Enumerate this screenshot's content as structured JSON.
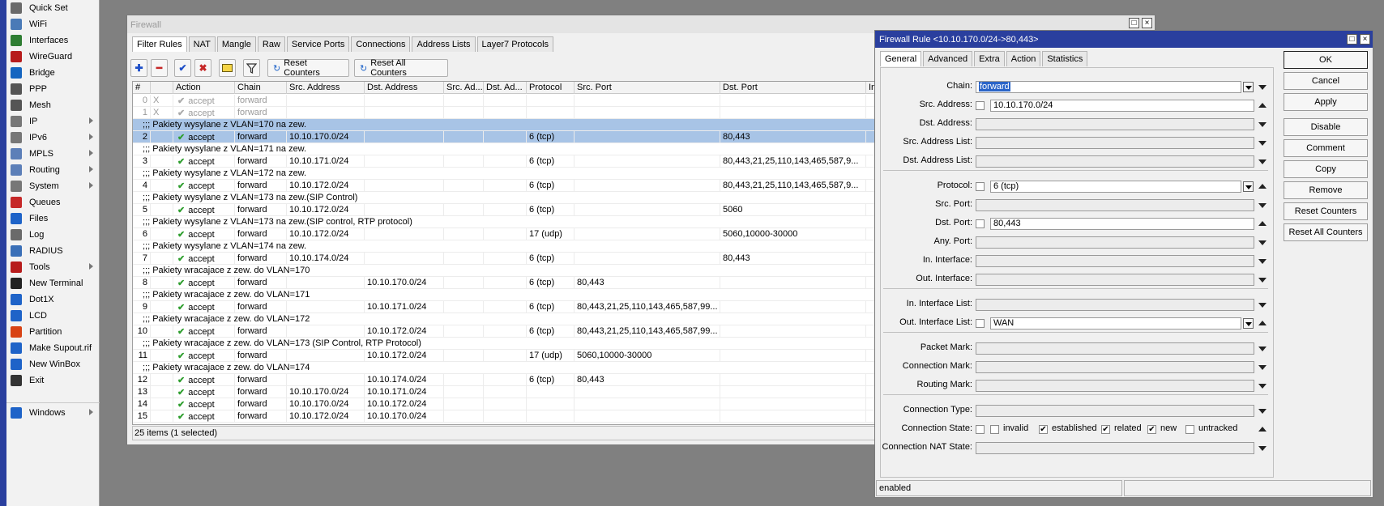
{
  "sidebar": {
    "items": [
      {
        "label": "Quick Set",
        "icon": "quick-set-icon",
        "color": "#6a6a6a",
        "sub": false
      },
      {
        "label": "WiFi",
        "icon": "wifi-icon",
        "color": "#4a7ab7",
        "sub": false
      },
      {
        "label": "Interfaces",
        "icon": "interfaces-icon",
        "color": "#2e7d32",
        "sub": false
      },
      {
        "label": "WireGuard",
        "icon": "wireguard-icon",
        "color": "#b71c1c",
        "sub": false
      },
      {
        "label": "Bridge",
        "icon": "bridge-icon",
        "color": "#1565c0",
        "sub": false
      },
      {
        "label": "PPP",
        "icon": "ppp-icon",
        "color": "#555555",
        "sub": false
      },
      {
        "label": "Mesh",
        "icon": "mesh-icon",
        "color": "#555555",
        "sub": false
      },
      {
        "label": "IP",
        "icon": "ip-icon",
        "color": "#777777",
        "sub": true
      },
      {
        "label": "IPv6",
        "icon": "ipv6-icon",
        "color": "#777777",
        "sub": true
      },
      {
        "label": "MPLS",
        "icon": "mpls-icon",
        "color": "#5c7fb8",
        "sub": true
      },
      {
        "label": "Routing",
        "icon": "routing-icon",
        "color": "#5c7fb8",
        "sub": true
      },
      {
        "label": "System",
        "icon": "system-icon",
        "color": "#777777",
        "sub": true
      },
      {
        "label": "Queues",
        "icon": "queues-icon",
        "color": "#c62828",
        "sub": false
      },
      {
        "label": "Files",
        "icon": "files-icon",
        "color": "#1e63c8",
        "sub": false
      },
      {
        "label": "Log",
        "icon": "log-icon",
        "color": "#6a6a6a",
        "sub": false
      },
      {
        "label": "RADIUS",
        "icon": "radius-icon",
        "color": "#3a6fb7",
        "sub": false
      },
      {
        "label": "Tools",
        "icon": "tools-icon",
        "color": "#b71c1c",
        "sub": true
      },
      {
        "label": "New Terminal",
        "icon": "terminal-icon",
        "color": "#222222",
        "sub": false
      },
      {
        "label": "Dot1X",
        "icon": "dot1x-icon",
        "color": "#1e63c8",
        "sub": false
      },
      {
        "label": "LCD",
        "icon": "lcd-icon",
        "color": "#1e63c8",
        "sub": false
      },
      {
        "label": "Partition",
        "icon": "partition-icon",
        "color": "#d84315",
        "sub": false
      },
      {
        "label": "Make Supout.rif",
        "icon": "supout-icon",
        "color": "#1e63c8",
        "sub": false
      },
      {
        "label": "New WinBox",
        "icon": "winbox-icon",
        "color": "#1e63c8",
        "sub": false
      },
      {
        "label": "Exit",
        "icon": "exit-icon",
        "color": "#333333",
        "sub": false
      },
      {
        "label": "Windows",
        "icon": "windows-icon",
        "color": "#1e63c8",
        "sub": true
      }
    ]
  },
  "firewall": {
    "title": "Firewall",
    "tabs": [
      "Filter Rules",
      "NAT",
      "Mangle",
      "Raw",
      "Service Ports",
      "Connections",
      "Address Lists",
      "Layer7 Protocols"
    ],
    "toolbar": {
      "reset_counters": "Reset Counters",
      "reset_all_counters": "Reset All Counters"
    },
    "columns": [
      "#",
      "",
      "Action",
      "Chain",
      "Src. Address",
      "Dst. Address",
      "Src. Ad...",
      "Dst. Ad...",
      "Protocol",
      "Src. Port",
      "Dst. Port",
      "In."
    ],
    "rows": [
      {
        "type": "rule",
        "num": "0",
        "x": "X",
        "action": "accept",
        "chain": "forward",
        "src": "",
        "dst": "",
        "proto": "",
        "sport": "",
        "dport": "",
        "disabled": true
      },
      {
        "type": "rule",
        "num": "1",
        "x": "X",
        "action": "accept",
        "chain": "forward",
        "src": "",
        "dst": "",
        "proto": "",
        "sport": "",
        "dport": "",
        "disabled": true
      },
      {
        "type": "comment",
        "text": ";;; Pakiety wysylane z VLAN=170 na zew.",
        "sel": true
      },
      {
        "type": "rule",
        "num": "2",
        "x": "",
        "action": "accept",
        "chain": "forward",
        "src": "10.10.170.0/24",
        "dst": "",
        "proto": "6 (tcp)",
        "sport": "",
        "dport": "80,443",
        "sel": true
      },
      {
        "type": "comment",
        "text": ";;; Pakiety wysylane z VLAN=171 na zew."
      },
      {
        "type": "rule",
        "num": "3",
        "x": "",
        "action": "accept",
        "chain": "forward",
        "src": "10.10.171.0/24",
        "dst": "",
        "proto": "6 (tcp)",
        "sport": "",
        "dport": "80,443,21,25,110,143,465,587,9..."
      },
      {
        "type": "comment",
        "text": ";;; Pakiety wysylane z VLAN=172 na zew."
      },
      {
        "type": "rule",
        "num": "4",
        "x": "",
        "action": "accept",
        "chain": "forward",
        "src": "10.10.172.0/24",
        "dst": "",
        "proto": "6 (tcp)",
        "sport": "",
        "dport": "80,443,21,25,110,143,465,587,9..."
      },
      {
        "type": "comment",
        "text": ";;; Pakiety wysylane z VLAN=173 na zew.(SIP Control)"
      },
      {
        "type": "rule",
        "num": "5",
        "x": "",
        "action": "accept",
        "chain": "forward",
        "src": "10.10.172.0/24",
        "dst": "",
        "proto": "6 (tcp)",
        "sport": "",
        "dport": "5060"
      },
      {
        "type": "comment",
        "text": ";;; Pakiety wysylane z VLAN=173 na zew.(SIP control, RTP protocol)"
      },
      {
        "type": "rule",
        "num": "6",
        "x": "",
        "action": "accept",
        "chain": "forward",
        "src": "10.10.172.0/24",
        "dst": "",
        "proto": "17 (udp)",
        "sport": "",
        "dport": "5060,10000-30000"
      },
      {
        "type": "comment",
        "text": ";;; Pakiety wysylane z VLAN=174 na zew."
      },
      {
        "type": "rule",
        "num": "7",
        "x": "",
        "action": "accept",
        "chain": "forward",
        "src": "10.10.174.0/24",
        "dst": "",
        "proto": "6 (tcp)",
        "sport": "",
        "dport": "80,443"
      },
      {
        "type": "comment",
        "text": ";;; Pakiety wracajace z zew. do VLAN=170"
      },
      {
        "type": "rule",
        "num": "8",
        "x": "",
        "action": "accept",
        "chain": "forward",
        "src": "",
        "dst": "10.10.170.0/24",
        "proto": "6 (tcp)",
        "sport": "80,443",
        "dport": ""
      },
      {
        "type": "comment",
        "text": ";;; Pakiety wracajace z zew. do VLAN=171"
      },
      {
        "type": "rule",
        "num": "9",
        "x": "",
        "action": "accept",
        "chain": "forward",
        "src": "",
        "dst": "10.10.171.0/24",
        "proto": "6 (tcp)",
        "sport": "80,443,21,25,110,143,465,587,99...",
        "dport": ""
      },
      {
        "type": "comment",
        "text": ";;; Pakiety wracajace z zew. do VLAN=172"
      },
      {
        "type": "rule",
        "num": "10",
        "x": "",
        "action": "accept",
        "chain": "forward",
        "src": "",
        "dst": "10.10.172.0/24",
        "proto": "6 (tcp)",
        "sport": "80,443,21,25,110,143,465,587,99...",
        "dport": ""
      },
      {
        "type": "comment",
        "text": ";;; Pakiety wracajace z zew. do VLAN=173 (SIP Control, RTP Protocol)"
      },
      {
        "type": "rule",
        "num": "11",
        "x": "",
        "action": "accept",
        "chain": "forward",
        "src": "",
        "dst": "10.10.172.0/24",
        "proto": "17 (udp)",
        "sport": "5060,10000-30000",
        "dport": ""
      },
      {
        "type": "comment",
        "text": ";;; Pakiety wracajace z zew. do VLAN=174"
      },
      {
        "type": "rule",
        "num": "12",
        "x": "",
        "action": "accept",
        "chain": "forward",
        "src": "",
        "dst": "10.10.174.0/24",
        "proto": "6 (tcp)",
        "sport": "80,443",
        "dport": ""
      },
      {
        "type": "rule",
        "num": "13",
        "x": "",
        "action": "accept",
        "chain": "forward",
        "src": "10.10.170.0/24",
        "dst": "10.10.171.0/24",
        "proto": "",
        "sport": "",
        "dport": ""
      },
      {
        "type": "rule",
        "num": "14",
        "x": "",
        "action": "accept",
        "chain": "forward",
        "src": "10.10.170.0/24",
        "dst": "10.10.172.0/24",
        "proto": "",
        "sport": "",
        "dport": ""
      },
      {
        "type": "rule",
        "num": "15",
        "x": "",
        "action": "accept",
        "chain": "forward",
        "src": "10.10.172.0/24",
        "dst": "10.10.170.0/24",
        "proto": "",
        "sport": "",
        "dport": ""
      }
    ],
    "status": "25 items (1 selected)"
  },
  "dialog": {
    "title": "Firewall Rule <10.10.170.0/24->80,443>",
    "tabs": [
      "General",
      "Advanced",
      "Extra",
      "Action",
      "Statistics"
    ],
    "fields": {
      "chain": {
        "label": "Chain:",
        "value": "forward"
      },
      "src_address": {
        "label": "Src. Address:",
        "value": "10.10.170.0/24"
      },
      "dst_address": {
        "label": "Dst. Address:",
        "value": ""
      },
      "src_address_list": {
        "label": "Src. Address List:",
        "value": ""
      },
      "dst_address_list": {
        "label": "Dst. Address List:",
        "value": ""
      },
      "protocol": {
        "label": "Protocol:",
        "value": "6 (tcp)"
      },
      "src_port": {
        "label": "Src. Port:",
        "value": ""
      },
      "dst_port": {
        "label": "Dst. Port:",
        "value": "80,443"
      },
      "any_port": {
        "label": "Any. Port:",
        "value": ""
      },
      "in_interface": {
        "label": "In. Interface:",
        "value": ""
      },
      "out_interface": {
        "label": "Out. Interface:",
        "value": ""
      },
      "in_interface_list": {
        "label": "In. Interface List:",
        "value": ""
      },
      "out_interface_list": {
        "label": "Out. Interface List:",
        "value": "WAN"
      },
      "packet_mark": {
        "label": "Packet Mark:",
        "value": ""
      },
      "connection_mark": {
        "label": "Connection Mark:",
        "value": ""
      },
      "routing_mark": {
        "label": "Routing Mark:",
        "value": ""
      },
      "connection_type": {
        "label": "Connection Type:",
        "value": ""
      },
      "connection_state": {
        "label": "Connection State:"
      },
      "connection_nat_state": {
        "label": "Connection NAT State:",
        "value": ""
      }
    },
    "states": {
      "invalid": "invalid",
      "established": "established",
      "related": "related",
      "new": "new",
      "untracked": "untracked"
    },
    "buttons": {
      "ok": "OK",
      "cancel": "Cancel",
      "apply": "Apply",
      "disable": "Disable",
      "comment": "Comment",
      "copy": "Copy",
      "remove": "Remove",
      "reset_counters": "Reset Counters",
      "reset_all_counters": "Reset All Counters"
    },
    "status": "enabled"
  }
}
